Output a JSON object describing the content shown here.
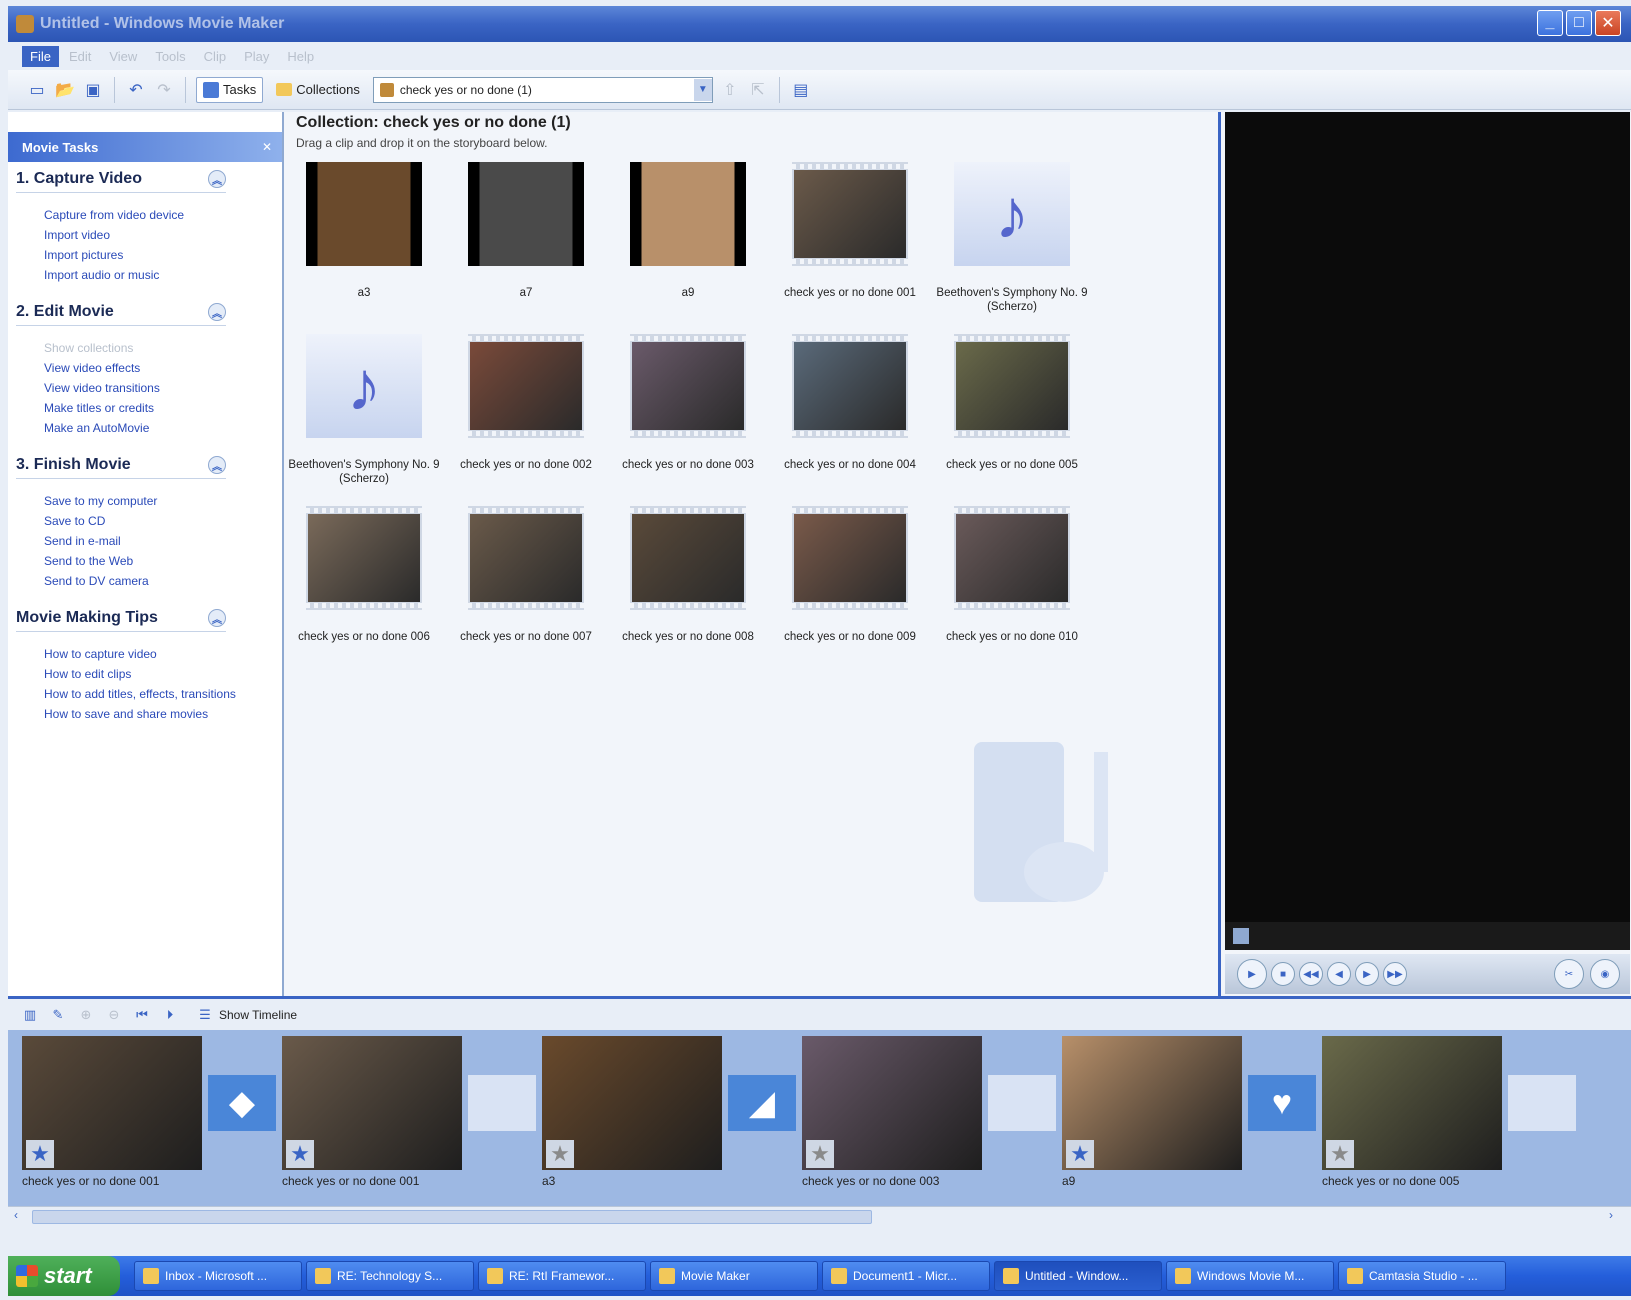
{
  "window": {
    "title": "Untitled - Windows Movie Maker"
  },
  "menu": [
    "File",
    "Edit",
    "View",
    "Tools",
    "Clip",
    "Play",
    "Help"
  ],
  "toolbar": {
    "tasks_label": "Tasks",
    "collections_label": "Collections",
    "collection_value": "check yes or no done (1)"
  },
  "task_pane": {
    "header": "Movie Tasks",
    "sections": [
      {
        "title": "1. Capture Video",
        "links": [
          "Capture from video device",
          "Import video",
          "Import pictures",
          "Import audio or music"
        ]
      },
      {
        "title": "2. Edit Movie",
        "links": [
          "Show collections",
          "View video effects",
          "View video transitions",
          "Make titles or credits",
          "Make an AutoMovie"
        ]
      },
      {
        "title": "3. Finish Movie",
        "links": [
          "Save to my computer",
          "Save to CD",
          "Send in e-mail",
          "Send to the Web",
          "Send to DV camera"
        ]
      },
      {
        "title": "Movie Making Tips",
        "links": [
          "How to capture video",
          "How to edit clips",
          "How to add titles, effects, transitions",
          "How to save and share movies"
        ]
      }
    ]
  },
  "collection": {
    "title": "Collection: check yes or no done (1)",
    "hint": "Drag a clip and drop it on the storyboard below.",
    "clips": [
      {
        "label": "a3",
        "type": "image",
        "color": "#6a4a2c"
      },
      {
        "label": "a7",
        "type": "image",
        "color": "#4a4a4a"
      },
      {
        "label": "a9",
        "type": "image",
        "color": "#b8906a"
      },
      {
        "label": "check yes or no done 001",
        "type": "video",
        "color": "#6b5a4a"
      },
      {
        "label": "Beethoven's Symphony No. 9 (Scherzo)",
        "type": "music",
        "color": "#5566cc"
      },
      {
        "label": "Beethoven's Symphony No. 9 (Scherzo)",
        "type": "music",
        "color": "#5566cc"
      },
      {
        "label": "check yes or no done 002",
        "type": "video",
        "color": "#7a4a3a"
      },
      {
        "label": "check yes or no done 003",
        "type": "video",
        "color": "#6a5a6a"
      },
      {
        "label": "check yes or no done 004",
        "type": "video",
        "color": "#5a6a7a"
      },
      {
        "label": "check yes or no done 005",
        "type": "video",
        "color": "#6a6a4a"
      },
      {
        "label": "check yes or no done 006",
        "type": "video",
        "color": "#7a6a5a"
      },
      {
        "label": "check yes or no done 007",
        "type": "video",
        "color": "#6a5a4a"
      },
      {
        "label": "check yes or no done 008",
        "type": "video",
        "color": "#5a4a3a"
      },
      {
        "label": "check yes or no done 009",
        "type": "video",
        "color": "#7a5a4a"
      },
      {
        "label": "check yes or no done 010",
        "type": "video",
        "color": "#6a5a5a"
      }
    ]
  },
  "storyboard": {
    "show_timeline_label": "Show Timeline",
    "clips": [
      {
        "label": "check yes or no done 001",
        "color": "#5a4a3a",
        "star": "blue"
      },
      {
        "label": "check yes or no done 001",
        "color": "#6a5a4a",
        "star": "blue"
      },
      {
        "label": "a3",
        "color": "#6a4a2c",
        "star": "plain"
      },
      {
        "label": "check yes or no done 003",
        "color": "#6a5a6a",
        "star": "plain"
      },
      {
        "label": "a9",
        "color": "#b8906a",
        "star": "blue"
      },
      {
        "label": "check yes or no done 005",
        "color": "#6a6a4a",
        "star": "plain"
      }
    ],
    "transitions": [
      {
        "kind": "filled",
        "icon": "diamond-icon"
      },
      {
        "kind": "empty",
        "icon": "arrow-icon"
      },
      {
        "kind": "filled",
        "icon": "page-curl-icon"
      },
      {
        "kind": "empty",
        "icon": "arrow-icon"
      },
      {
        "kind": "filled",
        "icon": "heart-icon"
      },
      {
        "kind": "empty",
        "icon": "arrow-icon"
      }
    ]
  },
  "taskbar": {
    "start_label": "start",
    "items": [
      "Inbox - Microsoft ...",
      "RE: Technology S...",
      "RE: RtI Framewor...",
      "Movie Maker",
      "Document1 - Micr...",
      "Untitled - Window...",
      "Windows Movie M...",
      "Camtasia Studio - ..."
    ],
    "active_index": 5
  }
}
